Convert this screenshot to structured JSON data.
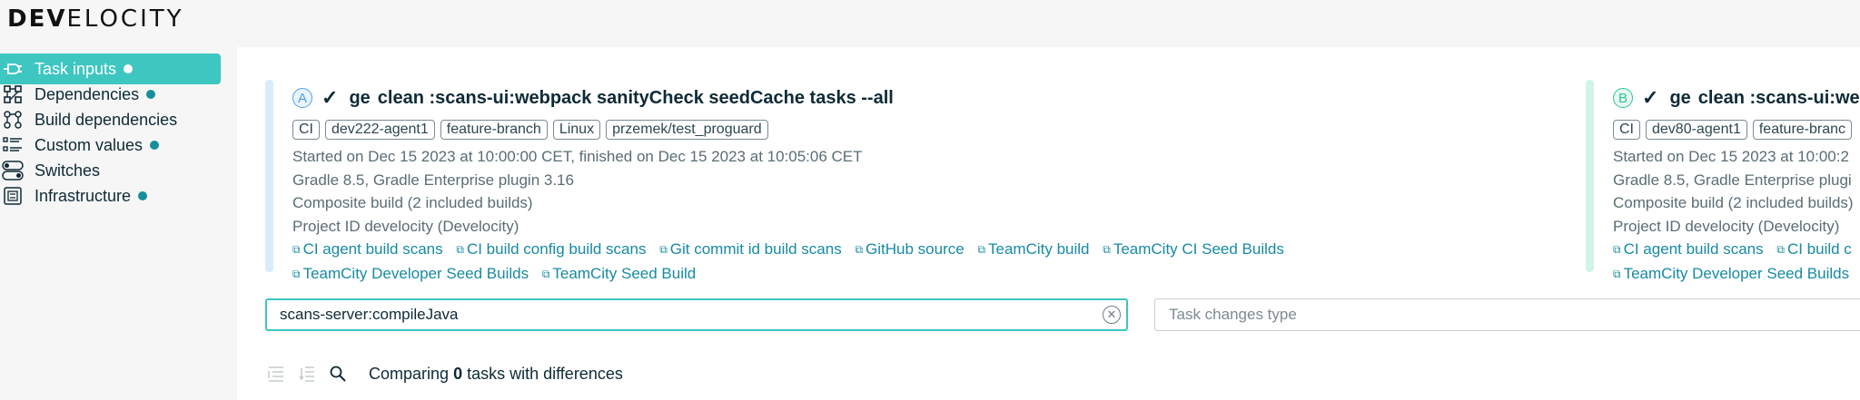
{
  "app": {
    "logo_text": "DEVELOCITY",
    "logo_prefix": "DEV",
    "logo_suffix": "ELOCITY"
  },
  "colors": {
    "accent": "#3ec6c1",
    "link": "#178aa3",
    "dot": "#168f9b",
    "build_a": "#4aa0e6",
    "build_b": "#2ec29a"
  },
  "sidebar": {
    "items": [
      {
        "label": "Task inputs",
        "icon": "plug-icon",
        "active": true,
        "dot": true
      },
      {
        "label": "Dependencies",
        "icon": "dependencies-icon",
        "active": false,
        "dot": true
      },
      {
        "label": "Build dependencies",
        "icon": "build-dependencies-icon",
        "active": false,
        "dot": false
      },
      {
        "label": "Custom values",
        "icon": "list-icon",
        "active": false,
        "dot": true
      },
      {
        "label": "Switches",
        "icon": "toggle-icon",
        "active": false,
        "dot": false
      },
      {
        "label": "Infrastructure",
        "icon": "chip-icon",
        "active": false,
        "dot": true
      }
    ]
  },
  "builds": [
    {
      "badge": "A",
      "prefix": "ge",
      "command": "clean :scans-ui:webpack sanityCheck seedCache tasks --all",
      "tags": [
        "CI",
        "dev222-agent1",
        "feature-branch",
        "Linux",
        "przemek/test_proguard"
      ],
      "started": "Started on Dec 15 2023 at 10:00:00 CET, finished on Dec 15 2023 at 10:05:06 CET",
      "gradle": "Gradle 8.5,  Gradle Enterprise plugin 3.16",
      "composite": "Composite build (2 included builds)",
      "project": "Project ID develocity (Develocity)",
      "links": [
        "CI agent build scans",
        "CI build config build scans",
        "Git commit id build scans",
        "GitHub source",
        "TeamCity build",
        "TeamCity CI Seed Builds",
        "TeamCity Developer Seed Builds",
        "TeamCity Seed Build"
      ]
    },
    {
      "badge": "B",
      "prefix": "ge",
      "command": "clean :scans-ui:web",
      "tags": [
        "CI",
        "dev80-agent1",
        "feature-branc"
      ],
      "started": "Started on Dec 15 2023 at 10:00:2",
      "gradle": "Gradle 8.5,  Gradle Enterprise plugi",
      "composite": "Composite build (2 included builds)",
      "project": "Project ID develocity (Develocity)",
      "links": [
        "CI agent build scans",
        "CI build c",
        "TeamCity Developer Seed Builds"
      ]
    }
  ],
  "filters": {
    "task_value": "scans-server:compileJava",
    "type_placeholder": "Task changes type"
  },
  "summary": {
    "prefix": "Comparing",
    "count": "0",
    "suffix": "tasks with differences"
  }
}
